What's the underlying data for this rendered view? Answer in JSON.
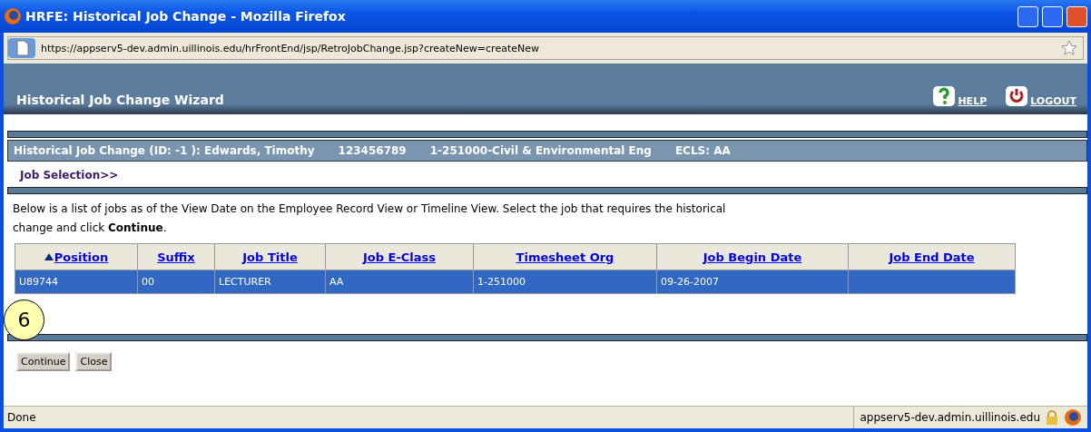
{
  "window": {
    "title": "HRFE: Historical Job Change - Mozilla Firefox"
  },
  "address_bar": {
    "url": "https://appserv5-dev.admin.uillinois.edu/hrFrontEnd/jsp/RetroJobChange.jsp?createNew=createNew"
  },
  "header": {
    "title": "Historical Job Change Wizard",
    "links": [
      {
        "label": "HELP",
        "kind": "help"
      },
      {
        "label": "LOGOUT",
        "kind": "logout"
      }
    ]
  },
  "info_bar": [
    "Historical Job Change (ID: -1 ): Edwards, Timothy",
    "123456789",
    "1-251000-Civil & Environmental Eng",
    "ECLS: AA"
  ],
  "breadcrumb": "Job Selection>>",
  "instructions": "Below is a list of jobs as of the View Date on the Employee Record View or Timeline View. Select the job that requires the historical change and click **Continue**.",
  "table": {
    "columns": [
      {
        "label": "Position",
        "sorted": true
      },
      {
        "label": "Suffix",
        "sorted": false
      },
      {
        "label": "Job Title",
        "sorted": false
      },
      {
        "label": "Job E-Class",
        "sorted": false
      },
      {
        "label": "Timesheet Org",
        "sorted": false
      },
      {
        "label": "Job Begin Date",
        "sorted": false
      },
      {
        "label": "Job End Date",
        "sorted": false
      }
    ],
    "rows": [
      {
        "selected": true,
        "cells": [
          "U89744",
          "00",
          "LECTURER",
          "AA",
          "1-251000",
          "09-26-2007",
          ""
        ]
      }
    ]
  },
  "callout": "6",
  "buttons": [
    "Continue",
    "Close"
  ],
  "status_bar": {
    "text": "Done",
    "host": "appserv5-dev.admin.uillinois.edu"
  }
}
